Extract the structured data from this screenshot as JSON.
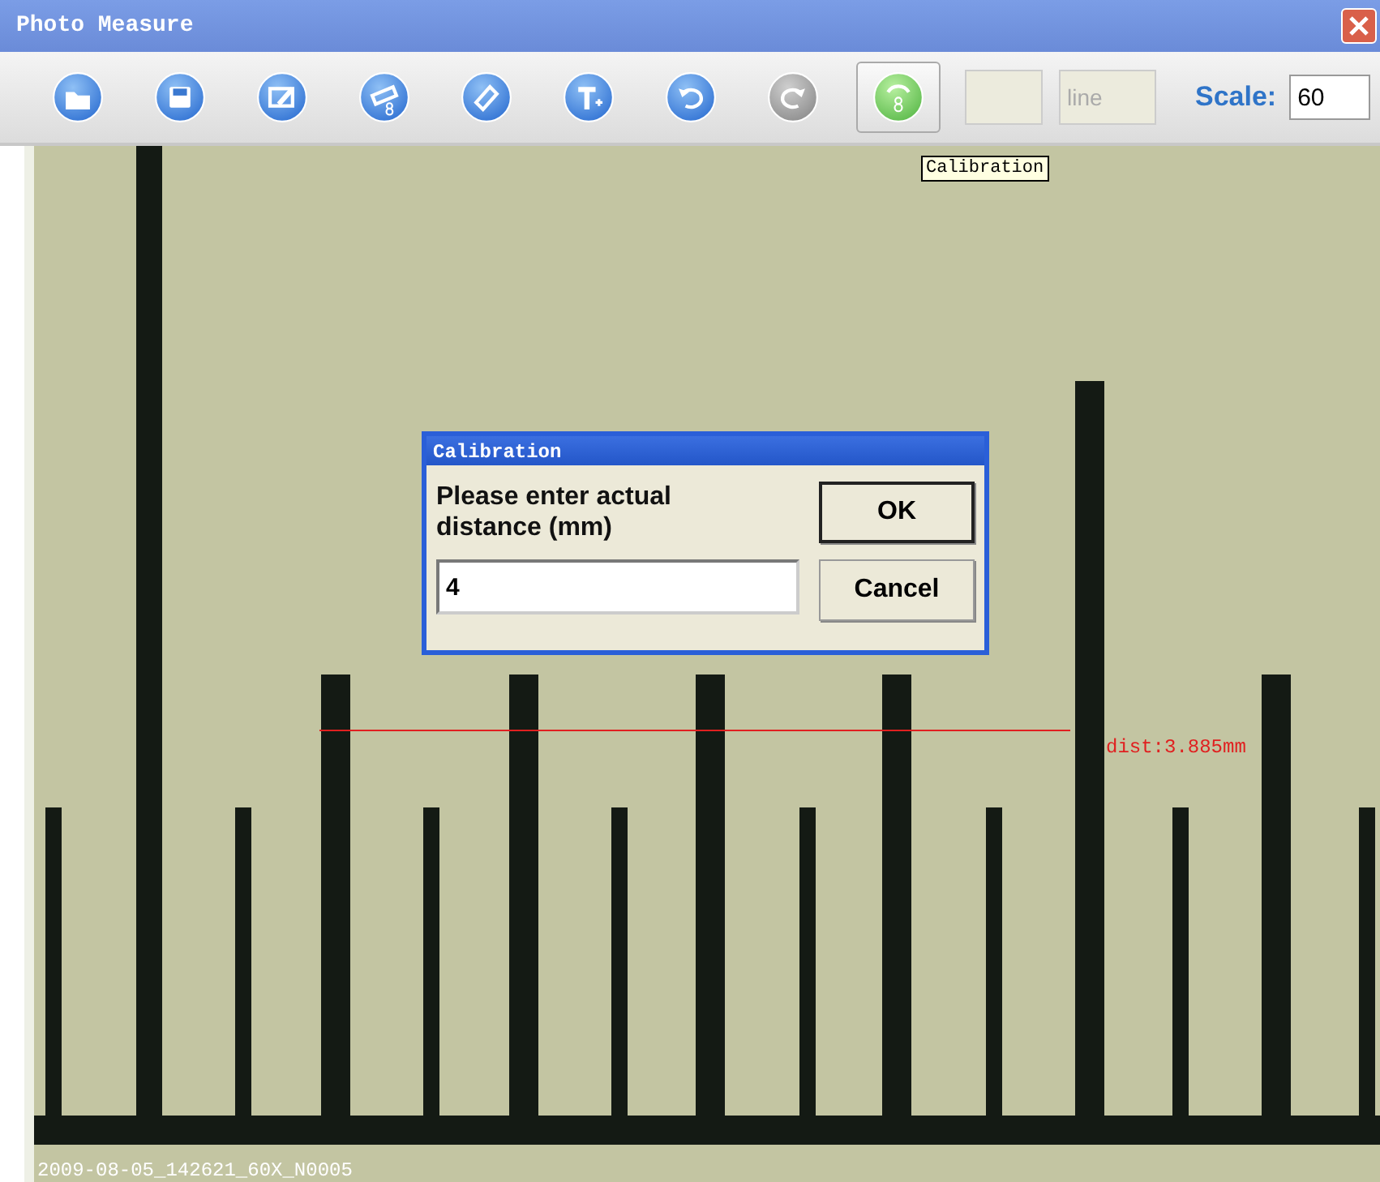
{
  "window": {
    "title": "Photo Measure"
  },
  "toolbar": {
    "tools": [
      {
        "kind": "open",
        "disabled": false,
        "selected": false
      },
      {
        "kind": "save",
        "disabled": false,
        "selected": false
      },
      {
        "kind": "edit",
        "disabled": false,
        "selected": false
      },
      {
        "kind": "measure",
        "disabled": false,
        "selected": false
      },
      {
        "kind": "erase",
        "disabled": false,
        "selected": false
      },
      {
        "kind": "text",
        "disabled": false,
        "selected": false
      },
      {
        "kind": "undo",
        "disabled": false,
        "selected": false
      },
      {
        "kind": "redo",
        "disabled": true,
        "selected": false
      },
      {
        "kind": "calibrate",
        "disabled": false,
        "selected": true
      }
    ],
    "fields": [
      {
        "disabled": true
      },
      {
        "placeholder": "line",
        "disabled": true
      }
    ],
    "scale": {
      "label": "Scale:",
      "value": "60"
    }
  },
  "tooltip": "Calibration",
  "image": {
    "measurement": "dist:3.885mm",
    "filename": "2009-08-05_142621_60X_N0005"
  },
  "dialog": {
    "title": "Calibration",
    "prompt": "Please enter actual distance (mm)",
    "value": "4",
    "buttons": [
      {
        "label": "OK",
        "default": true
      },
      {
        "label": "Cancel",
        "default": false
      }
    ]
  }
}
